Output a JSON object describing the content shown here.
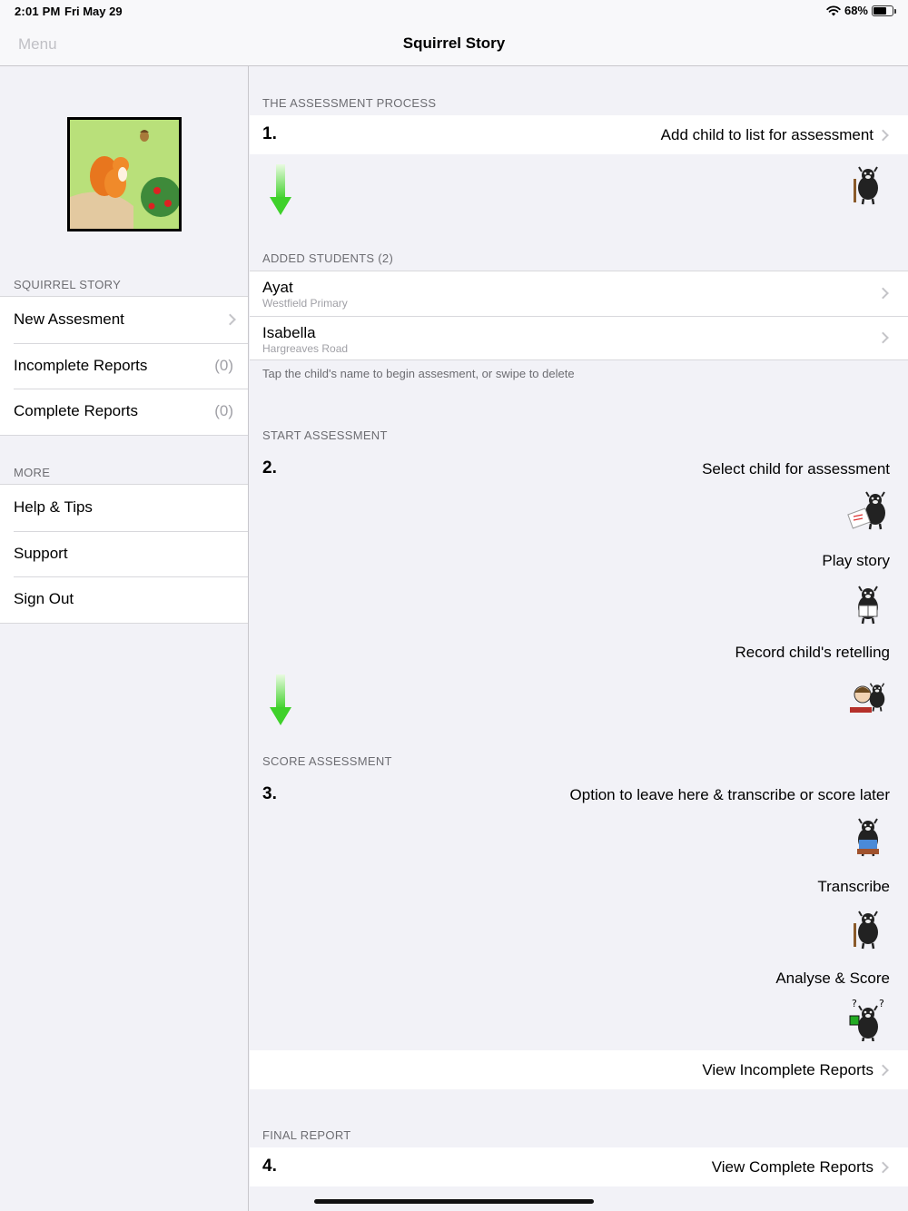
{
  "status": {
    "time": "2:01 PM",
    "date": "Fri May 29",
    "battery": "68%",
    "battery_level": 0.68,
    "wifi_icon": "wifi-icon"
  },
  "nav": {
    "menu": "Menu",
    "title": "Squirrel Story"
  },
  "sidebar": {
    "section1": "SQUIRREL STORY",
    "items": [
      {
        "label": "New Assesment",
        "count": ""
      },
      {
        "label": "Incomplete Reports",
        "count": "(0)"
      },
      {
        "label": "Complete Reports",
        "count": "(0)"
      }
    ],
    "section2": "MORE",
    "more": [
      {
        "label": "Help & Tips"
      },
      {
        "label": "Support"
      },
      {
        "label": "Sign Out"
      }
    ]
  },
  "main": {
    "process_header": "THE ASSESSMENT PROCESS",
    "step1_num": "1.",
    "step1_text": "Add child to list for assessment",
    "students_header": "ADDED STUDENTS (2)",
    "students": [
      {
        "name": "Ayat",
        "school": "Westfield Primary"
      },
      {
        "name": "Isabella",
        "school": "Hargreaves Road"
      }
    ],
    "hint": "Tap the child's name to begin assesment, or swipe to delete",
    "start_header": "START ASSESSMENT",
    "step2_num": "2.",
    "step2_items": [
      "Select child for assessment",
      "Play story",
      "Record child's retelling"
    ],
    "score_header": "SCORE ASSESSMENT",
    "step3_num": "3.",
    "step3_items": [
      "Option to leave here & transcribe or score later",
      "Transcribe",
      "Analyse & Score"
    ],
    "view_incomplete": "View Incomplete Reports",
    "final_header": "FINAL REPORT",
    "step4_num": "4.",
    "view_complete": "View Complete Reports"
  }
}
